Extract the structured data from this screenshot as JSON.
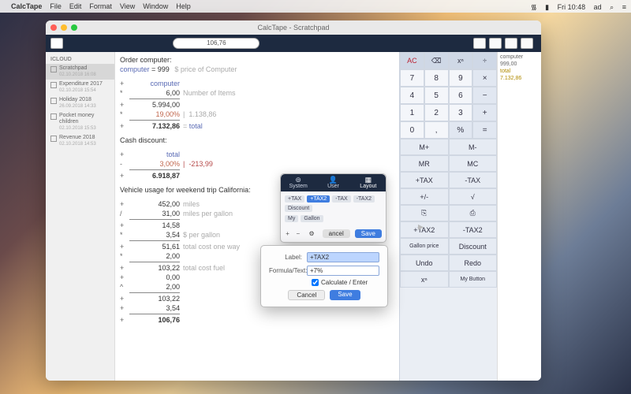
{
  "menubar": {
    "app": "CalcTape",
    "items": [
      "File",
      "Edit",
      "Format",
      "View",
      "Window",
      "Help"
    ],
    "right": {
      "wifi": "⏚",
      "clock": "Fri 10:48",
      "user": "ad",
      "search": "⌕",
      "menu": "≡"
    }
  },
  "window": {
    "title": "CalcTape - Scratchpad",
    "toolbar_value": "106,76"
  },
  "sidebar": {
    "section": "ICLOUD",
    "items": [
      {
        "title": "Scratchpad",
        "sub": "02.10.2018 16:08"
      },
      {
        "title": "Expenditure 2017",
        "sub": "02.10.2018 15:54"
      },
      {
        "title": "Holiday 2018",
        "sub": "26.09.2018 14:33"
      },
      {
        "title": "Pocket money children",
        "sub": "02.10.2018 15:53"
      },
      {
        "title": "Revenue 2018",
        "sub": "02.10.2018 14:53"
      }
    ]
  },
  "tape": {
    "t1": "Order computer:",
    "l_def": "computer",
    "l_def_v": " = 999 ",
    "l_def_n": "$ price of Computer",
    "r1_op": "+",
    "r1_kw": "computer",
    "r2_op": "*",
    "r2_v": "6,00",
    "r2_n": "Number of Items",
    "r3_op": "+",
    "r3_v": "5.994,00",
    "r4_op": "*",
    "r4_v": "19,00%",
    "r4_n": "|  1.138,86",
    "r5_op": "+",
    "r5_v": "7.132,86",
    "r5_n": "= ",
    "r5_kw": "total",
    "t2": "Cash discount:",
    "r6_op": "+",
    "r6_kw": "total",
    "r7_op": "-",
    "r7_v": "3,00%",
    "r7_n": "|  -213,99",
    "r8_op": "+",
    "r8_v": "6.918,87",
    "t3": "Vehicle usage for weekend trip California:",
    "r9_op": "+",
    "r9_v": "452,00",
    "r9_n": "miles",
    "r10_op": "/",
    "r10_v": "31,00",
    "r10_n": "miles per gallon",
    "r11_op": "+",
    "r11_v": "14,58",
    "r12_op": "*",
    "r12_v": "3,54",
    "r12_n": "$ per gallon",
    "r13_op": "+",
    "r13_v": "51,61",
    "r13_n": "total cost one way",
    "r14_op": "*",
    "r14_v": "2,00",
    "r15_op": "+",
    "r15_v": "103,22",
    "r15_n": "total cost fuel",
    "r16_op": "+",
    "r16_v": "0,00",
    "r17_op": "^",
    "r17_v": "2,00",
    "r18_op": "+",
    "r18_v": "103,22",
    "r19_op": "+",
    "r19_v": "3,54",
    "r20_op": "+",
    "r20_v": "106,76"
  },
  "keypad": {
    "top": [
      "AC",
      "⌫",
      "xⁿ",
      "÷"
    ],
    "rows": [
      [
        "7",
        "8",
        "9",
        "×"
      ],
      [
        "4",
        "5",
        "6",
        "−"
      ],
      [
        "1",
        "2",
        "3",
        "+"
      ],
      [
        "0",
        ",",
        "%",
        "="
      ]
    ],
    "mem": [
      "M+",
      "M-",
      "MR",
      "MC",
      "+TAX",
      "-TAX",
      "+/-",
      "√",
      "⎘",
      "⎙",
      "+TAX2",
      "-TAX2",
      "Gallon price",
      "Discount",
      "Undo",
      "Redo",
      "xⁿ",
      "My Button"
    ]
  },
  "notes": {
    "l1": "computer",
    "l1v": "999,00",
    "l2": "total",
    "l2v": "7.132,86"
  },
  "popover": {
    "tabs": [
      "System",
      "User",
      "Layout"
    ],
    "chips": [
      "+TAX",
      "+TAX2",
      "-TAX",
      "-TAX2",
      "Discount",
      "My",
      "Gallon"
    ],
    "plus": "+",
    "minus": "−",
    "gear": "⚙",
    "cancel": "ancel",
    "save": "Save"
  },
  "dialog": {
    "label_l": "Label:",
    "label_v": "+TAX2",
    "formula_l": "Formula/Text:",
    "formula_v": "+7%",
    "check": "Calculate / Enter",
    "cancel": "Cancel",
    "save": "Save"
  }
}
